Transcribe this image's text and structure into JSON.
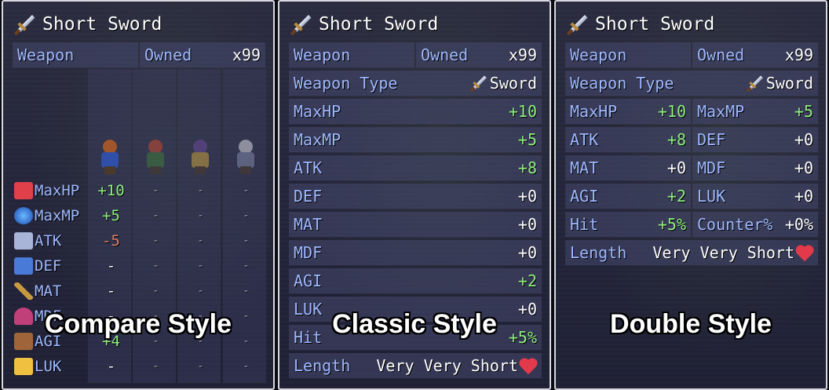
{
  "item_name": "Short Sword",
  "weapon_label": "Weapon",
  "owned_label": "Owned",
  "owned_count": "x99",
  "weapon_type_label": "Weapon Type",
  "weapon_type_value": "Sword",
  "length_label": "Length",
  "length_value": "Very Very Short",
  "compare": {
    "style_label": "Compare Style",
    "rows": [
      {
        "label": "MaxHP",
        "icon": "heart-icon",
        "value": "+10",
        "others": [
          "-",
          "-",
          "-"
        ]
      },
      {
        "label": "MaxMP",
        "icon": "orb-icon",
        "value": "+5",
        "others": [
          "-",
          "-",
          "-"
        ]
      },
      {
        "label": "ATK",
        "icon": "attack-icon",
        "value": "-5",
        "others": [
          "-",
          "-",
          "-"
        ]
      },
      {
        "label": "DEF",
        "icon": "defense-icon",
        "value": "-",
        "others": [
          "-",
          "-",
          "-"
        ]
      },
      {
        "label": "MAT",
        "icon": "staff-icon",
        "value": "-",
        "others": [
          "-",
          "-",
          "-"
        ]
      },
      {
        "label": "MDF",
        "icon": "hat-icon",
        "value": "-",
        "others": [
          "-",
          "-",
          "-"
        ]
      },
      {
        "label": "AGI",
        "icon": "boot-icon",
        "value": "+4",
        "others": [
          "-",
          "-",
          "-"
        ]
      },
      {
        "label": "LUK",
        "icon": "star-icon",
        "value": "-",
        "others": [
          "-",
          "-",
          "-"
        ]
      }
    ]
  },
  "classic": {
    "style_label": "Classic Style",
    "rows": [
      {
        "label": "MaxHP",
        "value": "+10"
      },
      {
        "label": "MaxMP",
        "value": "+5"
      },
      {
        "label": "ATK",
        "value": "+8"
      },
      {
        "label": "DEF",
        "value": "+0"
      },
      {
        "label": "MAT",
        "value": "+0"
      },
      {
        "label": "MDF",
        "value": "+0"
      },
      {
        "label": "AGI",
        "value": "+2"
      },
      {
        "label": "LUK",
        "value": "+0"
      },
      {
        "label": "Hit",
        "value": "+5%"
      }
    ]
  },
  "double": {
    "style_label": "Double Style",
    "rows": [
      {
        "l1": "MaxHP",
        "v1": "+10",
        "l2": "MaxMP",
        "v2": "+5"
      },
      {
        "l1": "ATK",
        "v1": "+8",
        "l2": "DEF",
        "v2": "+0"
      },
      {
        "l1": "MAT",
        "v1": "+0",
        "l2": "MDF",
        "v2": "+0"
      },
      {
        "l1": "AGI",
        "v1": "+2",
        "l2": "LUK",
        "v2": "+0"
      },
      {
        "l1": "Hit",
        "v1": "+5%",
        "l2": "Counter%",
        "v2": "+0%"
      }
    ]
  }
}
